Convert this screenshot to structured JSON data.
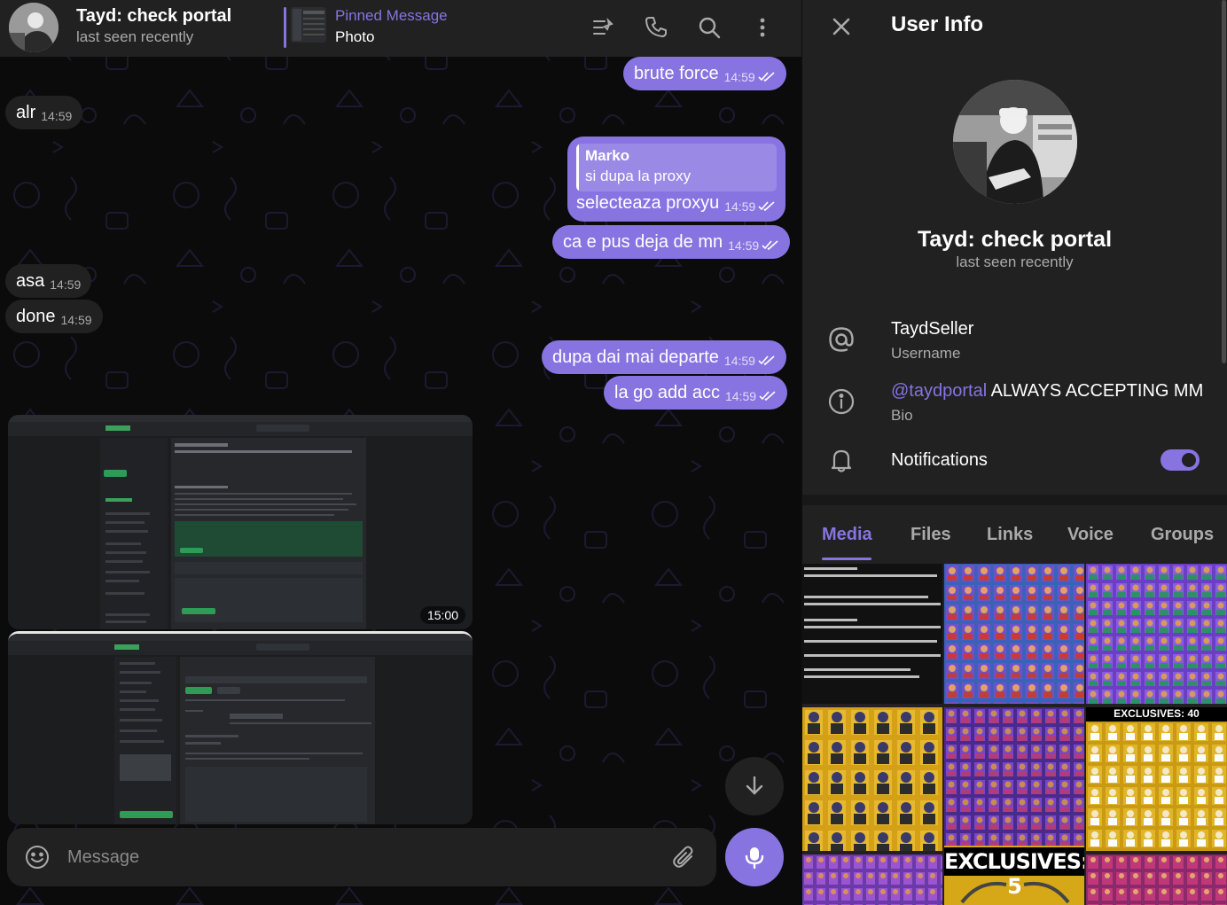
{
  "chat": {
    "title": "Tayd: check portal",
    "status": "last seen recently",
    "pinned": {
      "label": "Pinned Message",
      "text": "Photo"
    },
    "messages": [
      {
        "text": "brute force",
        "time": "14:59"
      },
      {
        "text": "alr",
        "time": "14:59"
      },
      {
        "reply_name": "Marko",
        "reply_text": "si dupa la proxy",
        "text": "selecteaza proxyu",
        "time": "14:59"
      },
      {
        "text": "ca e pus deja de mn",
        "time": "14:59"
      },
      {
        "text": "asa",
        "time": "14:59"
      },
      {
        "text": "done",
        "time": "14:59"
      },
      {
        "text": "dupa dai mai departe",
        "time": "14:59"
      },
      {
        "text": "la go add acc",
        "time": "14:59"
      },
      {
        "text": "",
        "time": "15:00"
      }
    ],
    "composer_placeholder": "Message"
  },
  "info": {
    "title": "User Info",
    "name": "Tayd: check portal",
    "status": "last seen recently",
    "username": "TaydSeller",
    "username_label": "Username",
    "bio_link": "@taydportal",
    "bio_text": " ALWAYS ACCEPTING MM",
    "bio_label": "Bio",
    "notifications_label": "Notifications",
    "notifications_on": true,
    "tabs": [
      "Media",
      "Files",
      "Links",
      "Voice",
      "Groups"
    ],
    "active_tab": "Media",
    "media_texts": {
      "exclusives_40": "EXCLUSIVES: 40",
      "exclusives_5": "EXCLUSIVES: 5"
    }
  },
  "colors": {
    "accent": "#8774e1",
    "panel": "#212121",
    "chat_bg": "#0b0b0b"
  }
}
